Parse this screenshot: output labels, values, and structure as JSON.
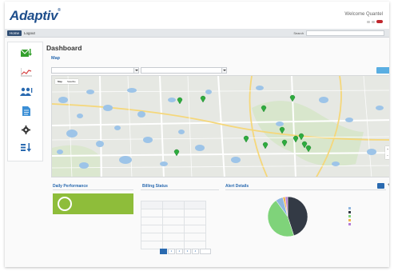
{
  "header": {
    "logo": "Adaptiv",
    "welcome": "Welcome Quantel"
  },
  "nav": {
    "home_label": "Home",
    "logout_label": "Logout",
    "search_label": "Search",
    "search_placeholder": ""
  },
  "sidebar": {
    "items": [
      {
        "label": "",
        "icon": "envelope-download-icon",
        "color": "#33a02c"
      },
      {
        "label": "",
        "icon": "line-chart-icon",
        "color": "#d64545"
      },
      {
        "label": "",
        "icon": "users-icon",
        "color": "#2a6ab0"
      },
      {
        "label": "",
        "icon": "document-icon",
        "color": "#3b8fd6"
      },
      {
        "label": "",
        "icon": "gear-icon",
        "color": "#333333"
      },
      {
        "label": "",
        "icon": "sort-bars-icon",
        "color": "#2a6ab0"
      }
    ]
  },
  "page": {
    "title": "Dashboard",
    "map_label": "Map",
    "filter1_value": "",
    "filter2_value": "",
    "refresh_label": ""
  },
  "map": {
    "type_map": "Map",
    "type_satellite": "Satellite",
    "pin_color": "#2eac3e"
  },
  "performance": {
    "title": "Daily Performance",
    "ring_value": "",
    "text": "",
    "sub": "",
    "color": "#8ebd3a"
  },
  "billing": {
    "title": "Billing Status",
    "columns": [
      "",
      "",
      ""
    ],
    "rows": [
      [
        "",
        "",
        ""
      ],
      [
        "",
        "",
        ""
      ],
      [
        "",
        "",
        ""
      ],
      [
        "",
        "",
        ""
      ],
      [
        "",
        "",
        ""
      ]
    ],
    "footer": "",
    "pages": [
      "",
      "1",
      "2",
      "3",
      "4",
      ""
    ]
  },
  "alerts": {
    "title": "Alert Details",
    "button_label": "",
    "legend": [
      {
        "label": "",
        "color": "#8fb6df"
      },
      {
        "label": "",
        "color": "#333a45"
      },
      {
        "label": "",
        "color": "#7fd37a"
      },
      {
        "label": "",
        "color": "#f0b54d"
      },
      {
        "label": "",
        "color": "#b57bd6"
      }
    ]
  },
  "chart_data": {
    "type": "pie",
    "values": [
      45,
      45,
      6,
      2,
      2
    ],
    "colors": [
      "#333a45",
      "#7fd37a",
      "#8fb6df",
      "#f0b54d",
      "#b57bd6"
    ]
  }
}
